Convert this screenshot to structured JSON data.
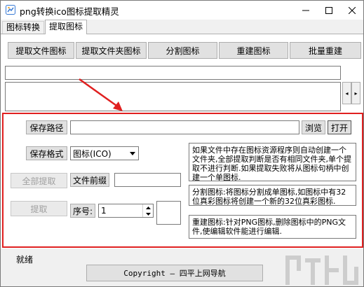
{
  "window": {
    "title": "png转换ico图标提取精灵",
    "controls": {
      "minimize": "—",
      "maximize": "☐",
      "close": "✕"
    }
  },
  "tabs": [
    {
      "label": "图标转换",
      "selected": false
    },
    {
      "label": "提取图标",
      "selected": true
    }
  ],
  "toolbar": {
    "extract_file_icon": "提取文件图标",
    "extract_folder_icon": "提取文件夹图标",
    "split_icon": "分割图标",
    "rebuild_icon": "重建图标",
    "batch_rebuild": "批量重建"
  },
  "path_field": {
    "value": ""
  },
  "list_box": {
    "value": ""
  },
  "list_scroll": {
    "left": "◂",
    "right": "▸"
  },
  "save_path": {
    "label": "保存路径",
    "value": "",
    "browse_label": "浏览",
    "open_label": "打开"
  },
  "save_format": {
    "label": "保存格式",
    "selected": "图标(ICO)"
  },
  "extract_all": {
    "label": "全部提取"
  },
  "file_prefix": {
    "label": "文件前缀",
    "value": ""
  },
  "extract": {
    "label": "提取"
  },
  "index": {
    "label": "序号:",
    "value": "1"
  },
  "info": {
    "extract_help": "如果文件中存在图标资源程序则自动创建一个文件夹,全部提取判断是否有相同文件夹,单个提取不进行判断.如果提取失败将从图标句柄中创建一个单图标.",
    "split_help": "分割图标:将图标分割成单图标,如图标中有32位真彩图标将创建一个新的32位真彩图标.",
    "rebuild_help": "重建图标:针对PNG图标,删除图标中的PNG文件,使编辑软件能进行编辑."
  },
  "status": {
    "text": "就绪"
  },
  "footer": {
    "copyright": "Copyright — 四平上网导航"
  },
  "colors": {
    "highlight": "#e02020",
    "arrow": "#e02020",
    "accent": "#0078d7"
  },
  "icons": [
    "app-icon",
    "minimize-icon",
    "maximize-icon",
    "close-icon",
    "dropdown-arrow-icon",
    "spin-up-icon",
    "spin-down-icon",
    "scroll-left-icon",
    "scroll-right-icon"
  ]
}
